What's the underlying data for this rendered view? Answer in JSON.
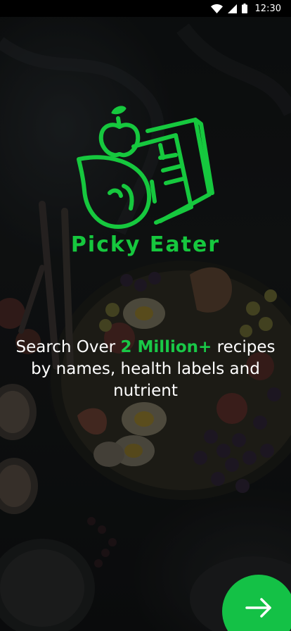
{
  "status_bar": {
    "time": "12:30",
    "icons": [
      "wifi-icon",
      "signal-icon",
      "battery-icon"
    ]
  },
  "logo": {
    "icon": "apple-leaf-book-icon",
    "name": "Picky Eater"
  },
  "tagline": {
    "before": "Search Over ",
    "highlight": "2 Million+",
    "after": " recipes by names, health labels and nutrient"
  },
  "next_button": {
    "icon": "arrow-right-icon"
  },
  "colors": {
    "brand_green": "#16c83e",
    "fab_green": "#14c146",
    "text": "#ffffff"
  }
}
